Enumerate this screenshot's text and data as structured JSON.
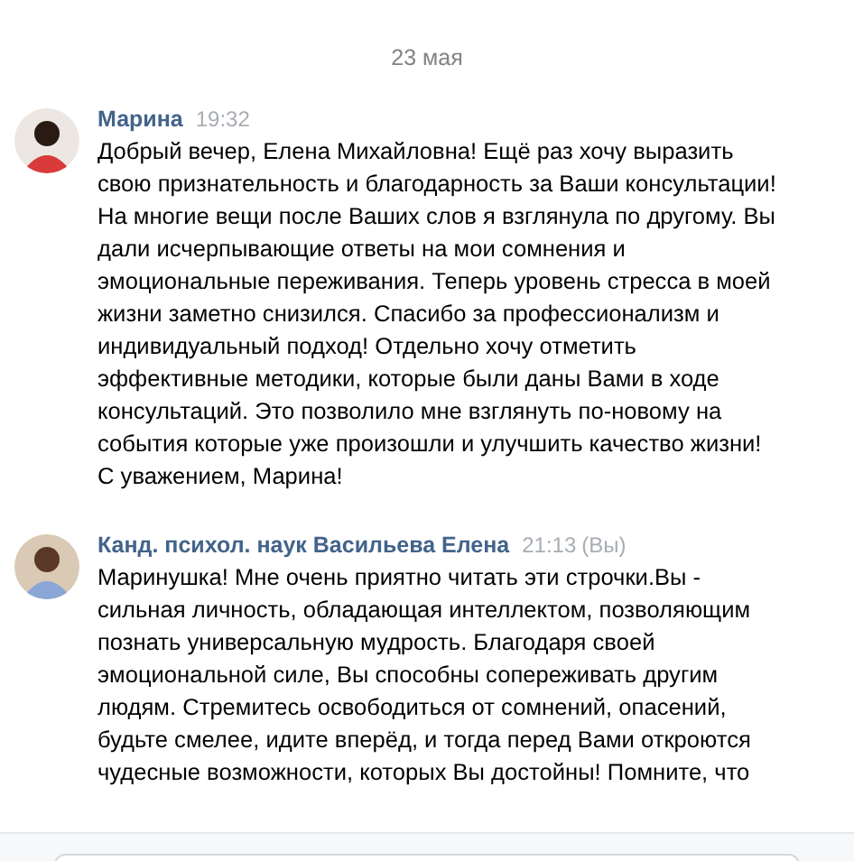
{
  "date": "23 мая",
  "messages": [
    {
      "author": "Марина",
      "time": "19:32",
      "text": "Добрый вечер, Елена Михайловна! Ещё раз хочу выразить свою признательность и благодарность за Ваши консультации! На многие вещи после Ваших слов я взглянула по другому. Вы дали исчерпывающие ответы на мои сомнения и эмоциональные переживания. Теперь уровень стресса в моей жизни заметно снизился. Спасибо за профессионализм и индивидуальный подход! Отдельно хочу отметить эффективные методики, которые были даны Вами в ходе консультаций. Это позволило мне взглянуть по-новому на события которые уже произошли и улучшить качество жизни!",
      "signature": "С уважением, Марина!"
    },
    {
      "author": "Канд. психол. наук Васильева Елена",
      "time": "21:13",
      "own_label": "(Вы)",
      "text": "Маринушка! Мне очень приятно читать эти строчки.Вы - сильная личность, обладающая интеллектом, позволяющим познать универсальную мудрость. Благодаря своей эмоциональной силе, Вы способны сопереживать другим людям. Стремитесь освободиться от сомнений, опасений, будьте смелее, идите вперёд, и тогда перед Вами откроются чудесные возможности, которых Вы достойны! Помните, что"
    }
  ]
}
